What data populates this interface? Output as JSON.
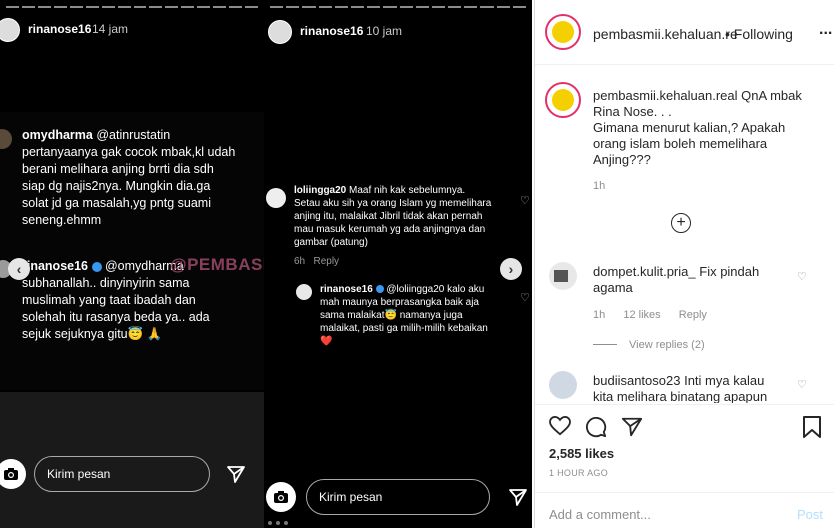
{
  "story1": {
    "username": "rinanose16",
    "time": "14 jam",
    "comment1_user": "omydharma",
    "comment1_mention": "@atinrustatin",
    "comment1_text_lines": [
      "pertanyaanya gak cocok mbak,kl udah",
      "berani melihara anjing brrti dia sdh",
      "siap dg najis2nya. Mungkin dia.ga",
      "solat jd ga masalah,yg pntg suami",
      "seneng.ehmm"
    ],
    "comment2_user": "rinanose16",
    "comment2_mention": "@omydharma",
    "comment2_text_lines": [
      "subhanallah.. dinyinyirin sama",
      "muslimah yang taat  ibadah dan",
      "solehah itu rasanya beda ya.. ada",
      "sejuk sejuknya gitu😇 🙏"
    ],
    "watermark": "@PEMBASMI.KEHALUAN.REAL",
    "message_placeholder": "Kirim pesan"
  },
  "story2": {
    "username": "rinanose16",
    "time": "10 jam",
    "comment1_user": "loliingga20",
    "comment1_text_lines": [
      "Maaf nih kak sebelumnya.",
      "Setau aku sih ya orang Islam yg memelihara",
      "anjing itu, malaikat Jibril tidak akan pernah",
      "mau masuk kerumah yg ada anjingnya dan",
      "gambar (patung)"
    ],
    "comment1_meta_time": "6h",
    "comment1_meta_reply": "Reply",
    "comment2_user": "rinanose16",
    "comment2_mention": "@loliingga20",
    "comment2_text_lines": [
      "kalo aku",
      "mah maunya berprasangka baik aja",
      "sama malaikat😇 namanya juga",
      "malaikat, pasti ga milih-milih kebaikan",
      "❤️"
    ],
    "message_placeholder": "Kirim pesan"
  },
  "post": {
    "account": "pembasmii.kehaluan.real",
    "account_header": "pembasmii.kehaluan.re",
    "following": "• Following",
    "more": "...",
    "caption_user": "pembasmii.kehaluan.real",
    "caption_lines": [
      "QnA mbak",
      "Rina Nose. . .",
      "Gimana menurut kalian,? Apakah",
      "orang islam boleh memelihara",
      "Anjing???"
    ],
    "caption_time": "1h",
    "comment1_user": "dompet.kulit.pria_",
    "comment1_text": "Fix pindah",
    "comment1_text2": "agama",
    "comment1_time": "1h",
    "comment1_likes": "12 likes",
    "comment1_reply": "Reply",
    "view_replies": "View replies (2)",
    "comment2_user": "budiisantoso23",
    "comment2_text": "Inti mya kalau",
    "comment2_text2": "kita melihara binatang apapun",
    "likes": "2,585 likes",
    "posted": "1 HOUR AGO",
    "add_comment_placeholder": "Add a comment...",
    "post_button": "Post"
  },
  "colors": {
    "brand_ring": "#e1306c",
    "link_blue": "#0095f6",
    "watermark": "#a04a6b"
  }
}
